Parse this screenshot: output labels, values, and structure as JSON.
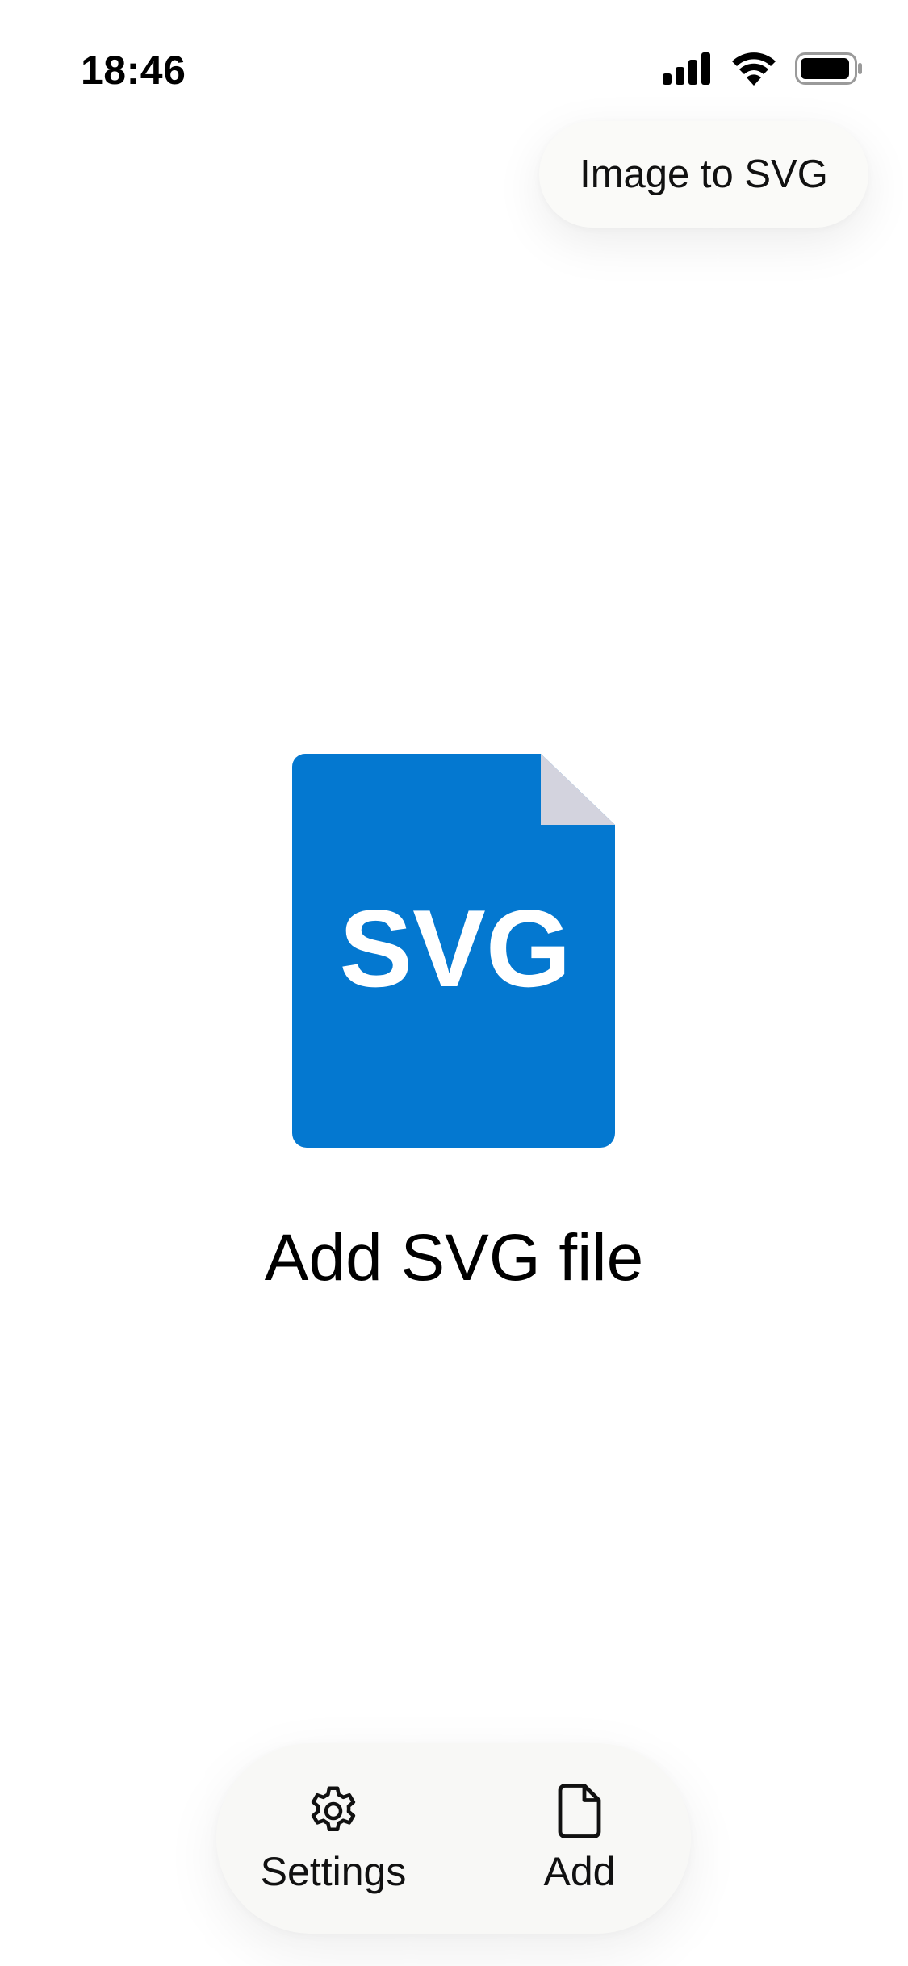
{
  "status_bar": {
    "time": "18:46"
  },
  "header": {
    "pill_label": "Image to SVG"
  },
  "empty_state": {
    "file_badge_text": "SVG",
    "label": "Add SVG file"
  },
  "bottom_bar": {
    "settings_label": "Settings",
    "add_label": "Add"
  },
  "colors": {
    "file_blue": "#0478D0",
    "file_fold": "#D3D3DE",
    "pill_bg": "#FAFAF8"
  },
  "icons": {
    "signal": "cellular-signal-icon",
    "wifi": "wifi-icon",
    "battery": "battery-icon",
    "settings": "gear-icon",
    "add": "document-icon"
  }
}
